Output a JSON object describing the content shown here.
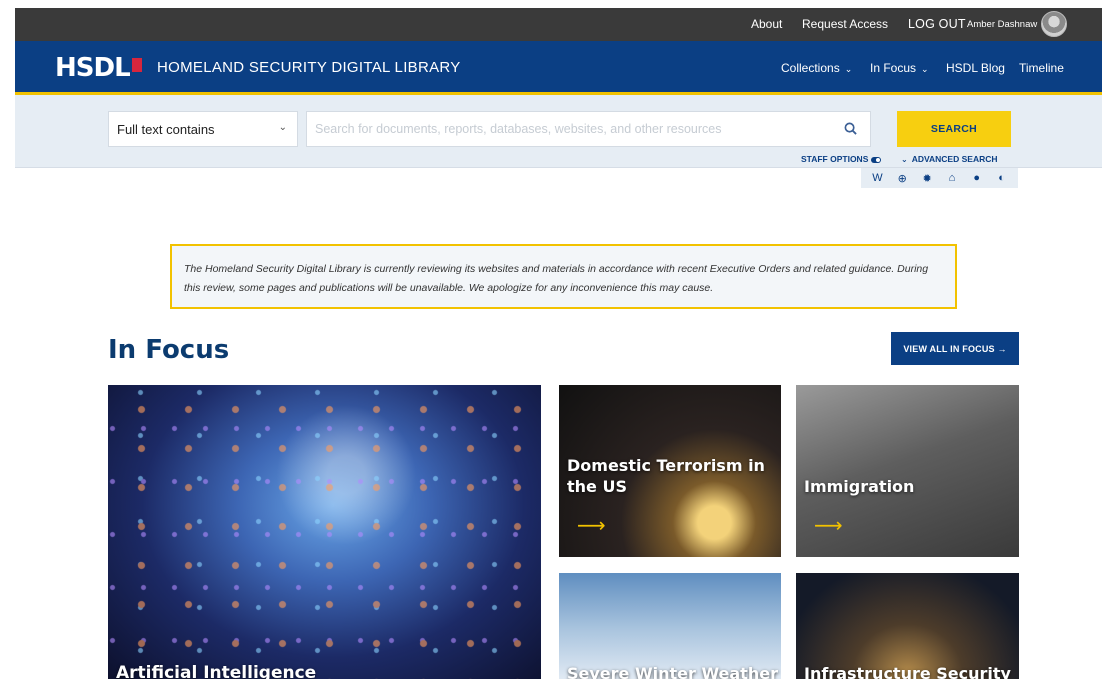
{
  "utility_bar": {
    "about": "About",
    "request_access": "Request Access",
    "logout": "LOG OUT",
    "user_name": "Amber Dashnaw"
  },
  "header": {
    "logo_text": "HSDL",
    "site_name": "HOMELAND SECURITY DIGITAL LIBRARY",
    "nav": {
      "collections": "Collections",
      "in_focus": "In Focus",
      "blog": "HSDL Blog",
      "timeline": "Timeline"
    }
  },
  "search": {
    "mode": "Full text contains",
    "placeholder": "Search for documents, reports, databases, websites, and other resources",
    "value": "",
    "button": "SEARCH",
    "staff_options": "STAFF OPTIONS",
    "advanced_search": "ADVANCED SEARCH"
  },
  "staff_tools": [
    {
      "icon": "wordpress-icon",
      "glyph": "W"
    },
    {
      "icon": "add-circle-icon",
      "glyph": "⊕"
    },
    {
      "icon": "gear-icon",
      "glyph": "✹"
    },
    {
      "icon": "institution-icon",
      "glyph": "⌂"
    },
    {
      "icon": "user-icon",
      "glyph": "●"
    },
    {
      "icon": "toggle-icon",
      "glyph": "◐"
    }
  ],
  "notice": {
    "text": "The Homeland Security Digital Library is currently reviewing its websites and materials in accordance with recent Executive Orders and related guidance. During this review, some pages and publications will be unavailable. We apologize for any inconvenience this may cause."
  },
  "in_focus": {
    "title": "In Focus",
    "view_all": "VIEW ALL IN FOCUS →",
    "cards": {
      "ai": "Artificial Intelligence",
      "terrorism": "Domestic Terrorism in the US",
      "immigration": "Immigration",
      "winter": "Severe Winter Weather",
      "infrastructure": "Infrastructure Security"
    },
    "arrow": "⟶"
  },
  "colors": {
    "header_blue": "#0b3f84",
    "accent_yellow": "#f2c200",
    "utility_dark": "#3a3a3a",
    "search_band": "#e6edf4"
  }
}
